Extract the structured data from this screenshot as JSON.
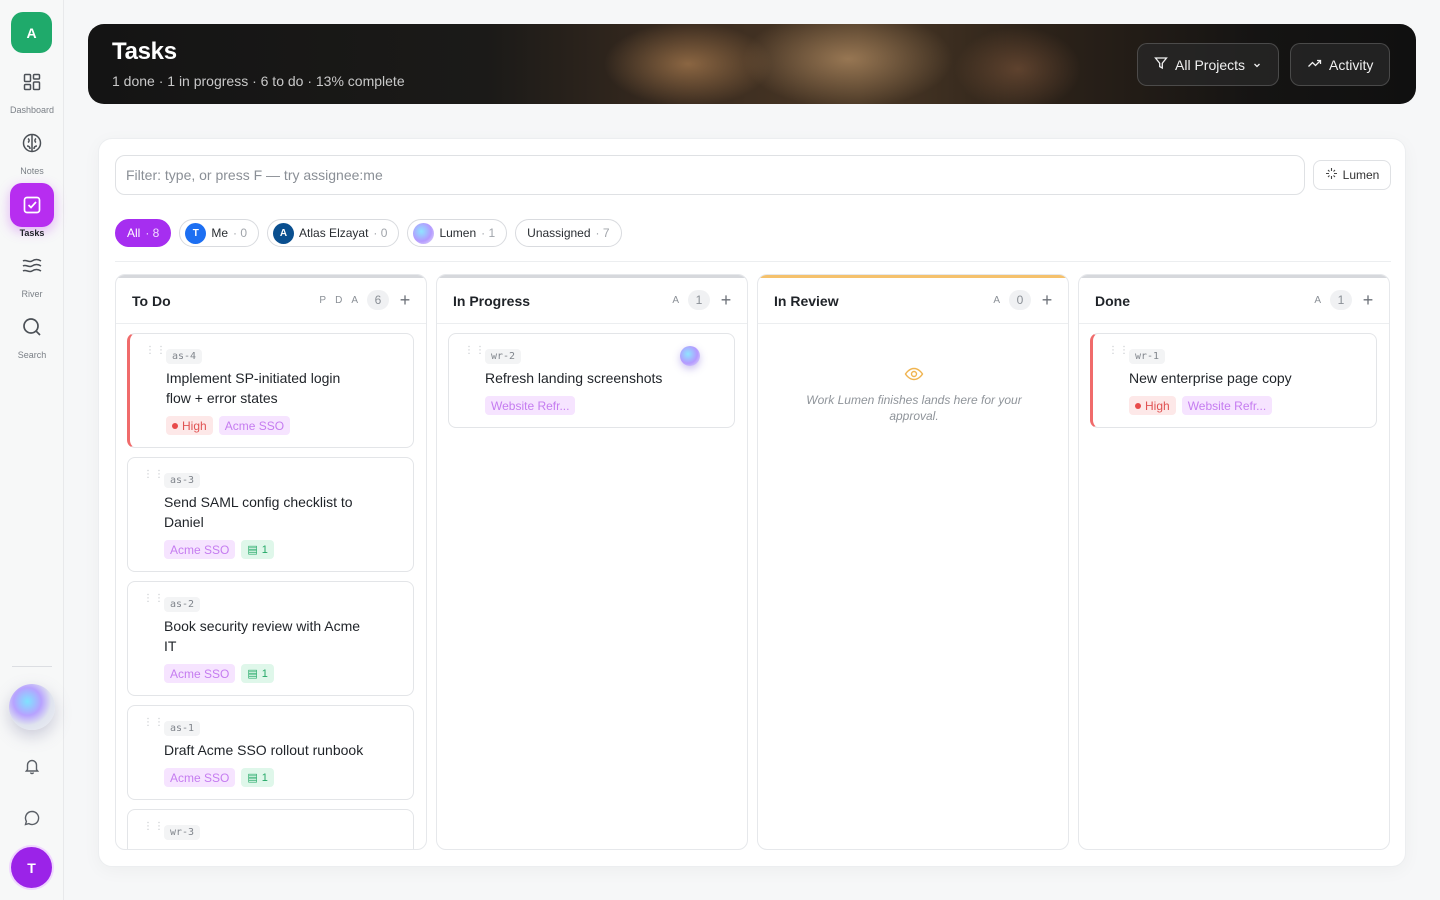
{
  "sidebar": {
    "workspace_initial": "A",
    "items": [
      {
        "label": "Dashboard",
        "icon": "grid-icon"
      },
      {
        "label": "Notes",
        "icon": "brain-icon"
      },
      {
        "label": "Tasks",
        "icon": "checkbox-icon",
        "active": true
      },
      {
        "label": "River",
        "icon": "waves-icon"
      },
      {
        "label": "Search",
        "icon": "search-icon"
      }
    ],
    "user_initial": "T"
  },
  "header": {
    "title": "Tasks",
    "subtitle": "1 done · 1 in progress · 6 to do · 13% complete",
    "projects_button": "All Projects",
    "activity_button": "Activity"
  },
  "filter": {
    "placeholder": "Filter: type, or press F — try assignee:me",
    "lumen_button": "Lumen"
  },
  "chips": [
    {
      "label": "All",
      "count": "· 8",
      "active": true
    },
    {
      "label": "Me",
      "count": "· 0",
      "avatar": "T",
      "avatar_color": "#1d6ff2"
    },
    {
      "label": "Atlas Elzayat",
      "count": "· 0",
      "avatar": "A",
      "avatar_color": "#0a4f8f"
    },
    {
      "label": "Lumen",
      "count": "· 1",
      "avatar": "orb"
    },
    {
      "label": "Unassigned",
      "count": "· 7"
    }
  ],
  "columns": [
    {
      "title": "To Do",
      "filters": [
        "P",
        "D",
        "A"
      ],
      "count": "6",
      "cards": [
        {
          "id": "as-4",
          "title": "Implement SP-initiated login flow + error states",
          "priority": "High",
          "project": "Acme SSO",
          "docs": ""
        },
        {
          "id": "as-3",
          "title": "Send SAML config checklist to Daniel",
          "priority": "",
          "project": "Acme SSO",
          "docs": "1"
        },
        {
          "id": "as-2",
          "title": "Book security review with Acme IT",
          "priority": "",
          "project": "Acme SSO",
          "docs": "1"
        },
        {
          "id": "as-1",
          "title": "Draft Acme SSO rollout runbook",
          "priority": "",
          "project": "Acme SSO",
          "docs": "1"
        },
        {
          "id": "wr-3",
          "title": "",
          "priority": "",
          "project": "",
          "docs": ""
        }
      ]
    },
    {
      "title": "In Progress",
      "filters": [
        "A"
      ],
      "count": "1",
      "cards": [
        {
          "id": "wr-2",
          "title": "Refresh landing screenshots",
          "priority": "",
          "project": "Website Refr...",
          "docs": "",
          "lumen": true
        }
      ]
    },
    {
      "title": "In Review",
      "filters": [
        "A"
      ],
      "count": "0",
      "empty_text": "Work Lumen finishes lands here for your approval.",
      "cards": []
    },
    {
      "title": "Done",
      "filters": [
        "A"
      ],
      "count": "1",
      "cards": [
        {
          "id": "wr-1",
          "title": "New enterprise page copy",
          "priority": "High",
          "project": "Website Refr...",
          "docs": ""
        }
      ]
    }
  ]
}
